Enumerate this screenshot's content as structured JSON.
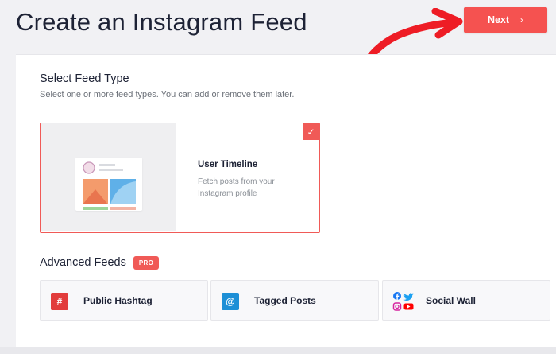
{
  "header": {
    "title": "Create an Instagram Feed",
    "next_label": "Next",
    "next_icon": "chevron-right-icon",
    "accent_color": "#f55250"
  },
  "feed_type": {
    "title": "Select Feed Type",
    "subtitle": "Select one or more feed types. You can add or remove them later.",
    "options": [
      {
        "title": "User Timeline",
        "description": "Fetch posts from your Instagram profile",
        "selected": true,
        "icon": "user-timeline-illustration"
      }
    ]
  },
  "advanced": {
    "title": "Advanced Feeds",
    "badge": "PRO",
    "items": [
      {
        "label": "Public Hashtag",
        "icon": "hashtag-icon",
        "color": "#e23c3c"
      },
      {
        "label": "Tagged Posts",
        "icon": "at-sign-icon",
        "color": "#1d8fd6"
      },
      {
        "label": "Social Wall",
        "icon": "social-icons",
        "color": "#1877f2"
      }
    ]
  }
}
